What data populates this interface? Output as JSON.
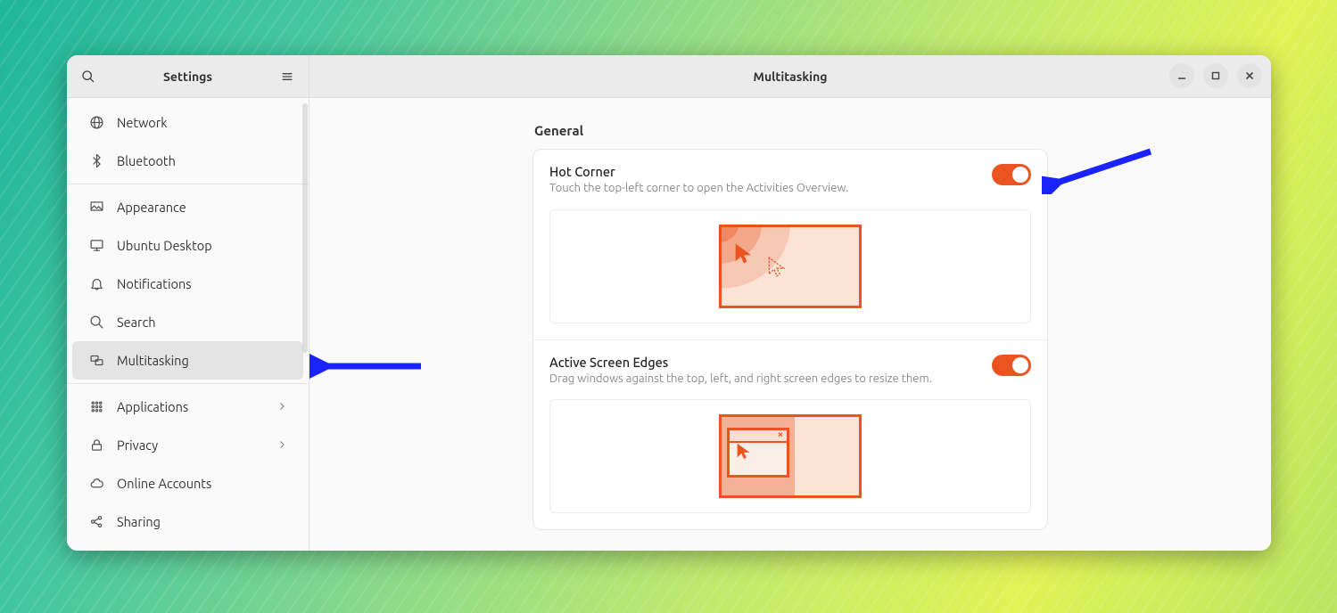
{
  "sidebar": {
    "title": "Settings",
    "items": [
      {
        "id": "network",
        "label": "Network",
        "icon": "globe"
      },
      {
        "id": "bluetooth",
        "label": "Bluetooth",
        "icon": "bluetooth"
      },
      {
        "sep": true
      },
      {
        "id": "appearance",
        "label": "Appearance",
        "icon": "appearance"
      },
      {
        "id": "ubuntu-desktop",
        "label": "Ubuntu Desktop",
        "icon": "desktop"
      },
      {
        "id": "notifications",
        "label": "Notifications",
        "icon": "bell"
      },
      {
        "id": "search",
        "label": "Search",
        "icon": "search"
      },
      {
        "id": "multitasking",
        "label": "Multitasking",
        "icon": "multitask",
        "selected": true
      },
      {
        "sep": true
      },
      {
        "id": "applications",
        "label": "Applications",
        "icon": "apps",
        "submenu": true
      },
      {
        "id": "privacy",
        "label": "Privacy",
        "icon": "lock",
        "submenu": true
      },
      {
        "id": "online-accounts",
        "label": "Online Accounts",
        "icon": "cloud"
      },
      {
        "id": "sharing",
        "label": "Sharing",
        "icon": "share"
      }
    ]
  },
  "main": {
    "title": "Multitasking",
    "section": "General",
    "hot_corner": {
      "title": "Hot Corner",
      "sub": "Touch the top-left corner to open the Activities Overview.",
      "enabled": true
    },
    "screen_edges": {
      "title": "Active Screen Edges",
      "sub": "Drag windows against the top, left, and right screen edges to resize them.",
      "enabled": true
    }
  },
  "colors": {
    "accent": "#e95420",
    "arrow": "#1a22ff"
  }
}
